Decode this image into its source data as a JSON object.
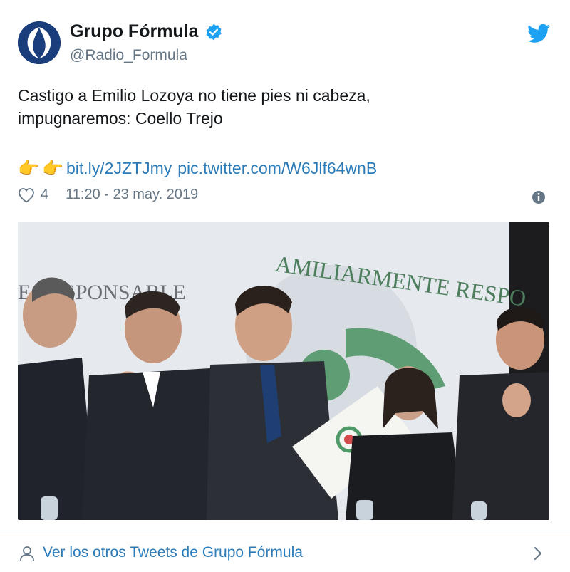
{
  "account": {
    "display_name": "Grupo Fórmula",
    "handle": "@Radio_Formula",
    "verified": true,
    "avatar_color": "#1a3d7c"
  },
  "tweet": {
    "text_line_1": "Castigo a Emilio Lozoya no tiene pies ni cabeza,",
    "text_line_2": "impugnaremos: Coello Trejo",
    "emoji_1": "👉",
    "emoji_2": "👉",
    "link_1": "bit.ly/2JZTJmy",
    "link_2": "pic.twitter.com/W6Jlf64wnB"
  },
  "meta": {
    "like_count": "4",
    "timestamp": "11:20 - 23 may. 2019"
  },
  "photo": {
    "banner_text_left": "E RESPONSABLE",
    "banner_text_arc": "AMILIARMENTE RESPO"
  },
  "footer": {
    "label": "Ver los otros Tweets de Grupo Fórmula"
  },
  "colors": {
    "link": "#2b7bb9",
    "twitter_blue": "#1da1f2",
    "secondary_text": "#657786"
  },
  "icons": [
    "verified-icon",
    "twitter-bird-icon",
    "heart-icon",
    "info-icon",
    "person-icon",
    "chevron-right-icon"
  ]
}
